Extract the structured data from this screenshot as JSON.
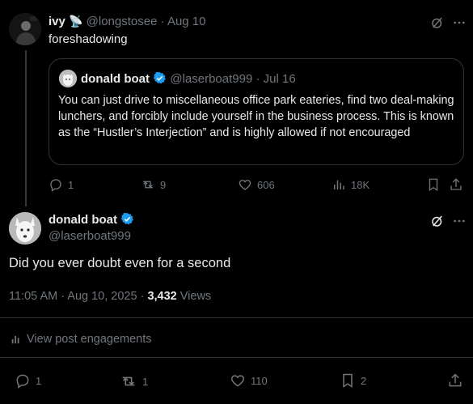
{
  "reply_tweet": {
    "name": "ivy",
    "handle": "@longstosee",
    "sep": "·",
    "date": "Aug 10",
    "text": "foreshadowing",
    "quoted": {
      "name": "donald boat",
      "handle": "@laserboat999",
      "sep": "·",
      "date": "Jul 16",
      "text": "You can just drive to miscellaneous office park eateries, find two deal-making lunchers, and forcibly include yourself in the business process. This is known as the “Hustler’s Interjection” and is highly allowed if not encouraged"
    },
    "actions": {
      "replies": "1",
      "reposts": "9",
      "likes": "606",
      "views": "18K"
    }
  },
  "main_tweet": {
    "name": "donald boat",
    "handle": "@laserboat999",
    "text": "Did you ever doubt even for a second",
    "time": "11:05 AM · Aug 10, 2025 · ",
    "views_count": "3,432",
    "views_label": " Views",
    "engagements_label": "View post engagements",
    "actions": {
      "replies": "1",
      "reposts": "1",
      "likes": "110",
      "bookmarks": "2"
    }
  },
  "colors": {
    "background": "#000000",
    "text": "#e7e9ea",
    "muted": "#71767b",
    "verified": "#1d9bf0",
    "border": "#2f3336"
  },
  "icons": [
    "satellite-dish-emoji",
    "grok-icon",
    "more-icon",
    "verified-badge-icon",
    "reply-icon",
    "repost-icon",
    "like-icon",
    "views-icon",
    "bookmark-icon",
    "share-icon"
  ]
}
